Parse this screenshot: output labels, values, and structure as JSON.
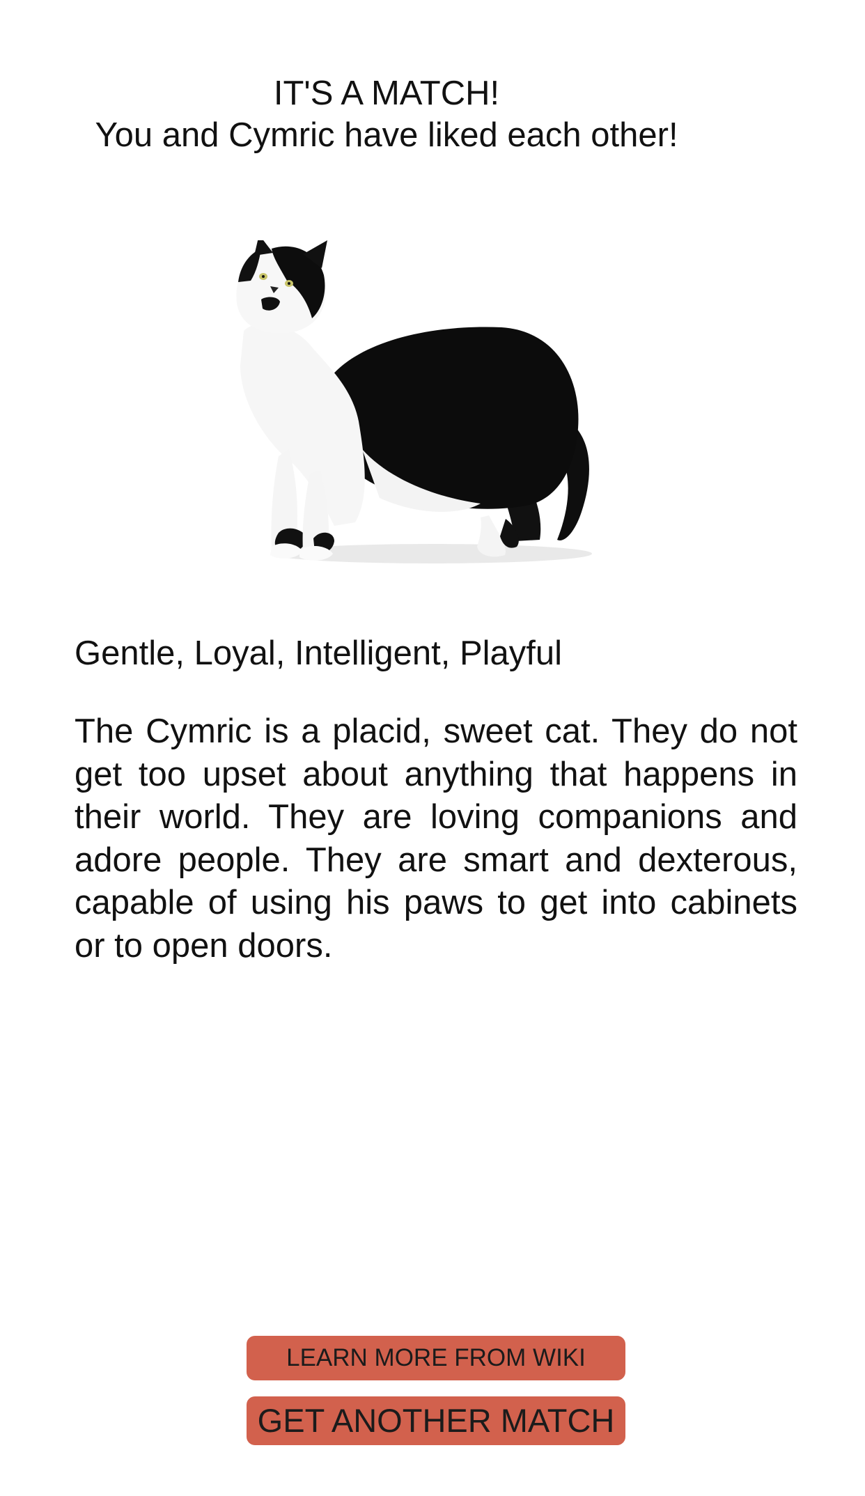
{
  "header": {
    "title": "IT'S A MATCH!",
    "subtitle": "You and Cymric have liked each other!"
  },
  "cat": {
    "breed": "Cymric",
    "image_icon": "cat-photo"
  },
  "traits": "Gentle, Loyal, Intelligent, Playful",
  "description": "The Cymric is a placid, sweet cat. They do not get too upset about anything that happens in their world. They are loving companions and adore people. They are smart and dexterous, capable of using his paws to get into cabinets or to open doors.",
  "buttons": {
    "wiki_label": "LEARN MORE FROM WIKI",
    "another_label": "GET ANOTHER MATCH"
  },
  "colors": {
    "button_bg": "#d2614d",
    "text": "#111111",
    "background": "#ffffff"
  }
}
